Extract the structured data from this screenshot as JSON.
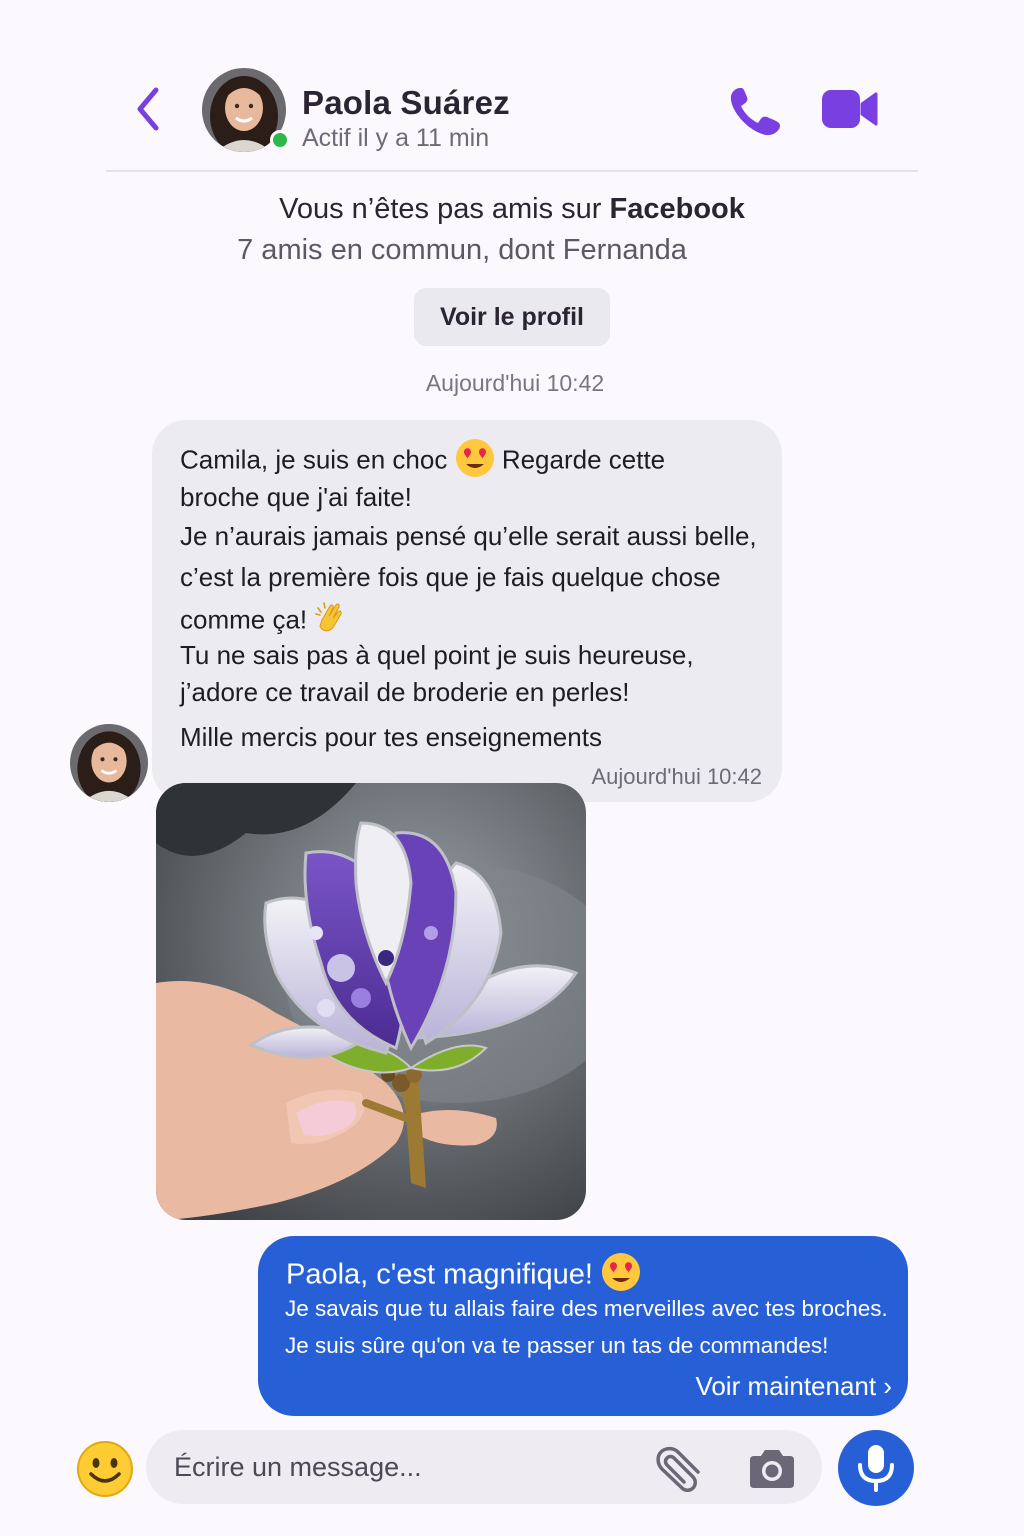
{
  "colors": {
    "accent": "#7a3fe0",
    "bubble_out": "#2760d6",
    "bubble_in": "#ecebf1",
    "online": "#2fb84a"
  },
  "header": {
    "back_icon": "chevron-left-icon",
    "name": "Paola Suárez",
    "status": "Actif il y a 11 min",
    "call_icon": "phone-icon",
    "video_icon": "video-camera-icon"
  },
  "notice": {
    "text": "Vous n’êtes pas amis sur ",
    "brand": "Facebook",
    "mutual": "7 amis en commun, dont Fernanda",
    "profile_button": "Voir le profil"
  },
  "date_separator": "Aujourd'hui 10:42",
  "incoming": {
    "lines": [
      "Camila, je suis en choc",
      "Regarde cette",
      "broche que j'ai faite!",
      "Je n’aurais jamais pensé qu’elle serait aussi belle,",
      "c’est la première fois que je fais quelque chose",
      "comme ça!",
      "Tu ne sais pas à quel point je suis heureuse,",
      "j’adore ce travail de broderie en perles!",
      "Mille mercis pour tes enseignements"
    ],
    "time": "Aujourd'hui 10:42",
    "emoji_1": "heart-eyes-emoji",
    "emoji_2": "clapping-hands-emoji"
  },
  "photo": {
    "subject": "beaded-lilac-magnolia-brooch-photo"
  },
  "outgoing": {
    "title": "Paola, c'est magnifique!",
    "emoji": "heart-eyes-emoji",
    "line1": "Je savais que tu allais faire des merveilles avec tes broches.",
    "line2": "Je suis sûre qu'on va te passer un tas de commandes!",
    "link": "Voir maintenant ›"
  },
  "composer": {
    "placeholder": "Écrire un message...",
    "emoji_icon": "smiley-icon",
    "attach_icon": "paperclip-icon",
    "camera_icon": "camera-icon",
    "mic_icon": "microphone-icon"
  }
}
